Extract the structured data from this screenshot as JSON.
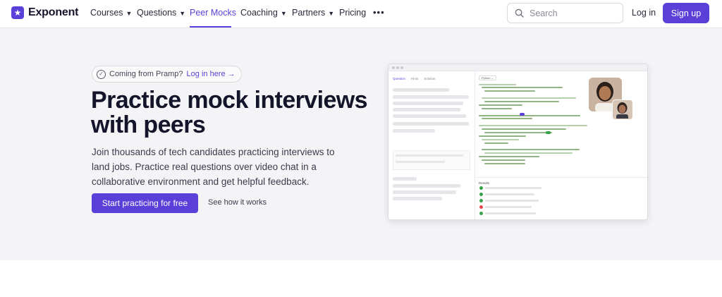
{
  "brand": {
    "name": "Exponent",
    "accent": "#5b3fd9"
  },
  "nav": {
    "items": [
      {
        "label": "Courses",
        "dropdown": true
      },
      {
        "label": "Questions",
        "dropdown": true
      },
      {
        "label": "Peer Mocks",
        "dropdown": false,
        "active": true
      },
      {
        "label": "Coaching",
        "dropdown": true
      },
      {
        "label": "Partners",
        "dropdown": true
      },
      {
        "label": "Pricing",
        "dropdown": false
      }
    ],
    "more_icon": "ellipsis-icon",
    "search_placeholder": "Search",
    "login": "Log in",
    "signup": "Sign up"
  },
  "hero": {
    "pill_text": "Coming from Pramp?",
    "pill_link": "Log in here →",
    "title": "Practice mock interviews with peers",
    "subtitle": "Join thousands of tech candidates practicing interviews to land jobs. Practice real questions over video chat in a collaborative environment and get helpful feedback.",
    "cta": "Start practicing for free",
    "secondary": "See how it works"
  },
  "mock": {
    "tabs": [
      "Question",
      "Hints",
      "Solution"
    ],
    "language": "Python ⌄",
    "results_label": "Results"
  }
}
